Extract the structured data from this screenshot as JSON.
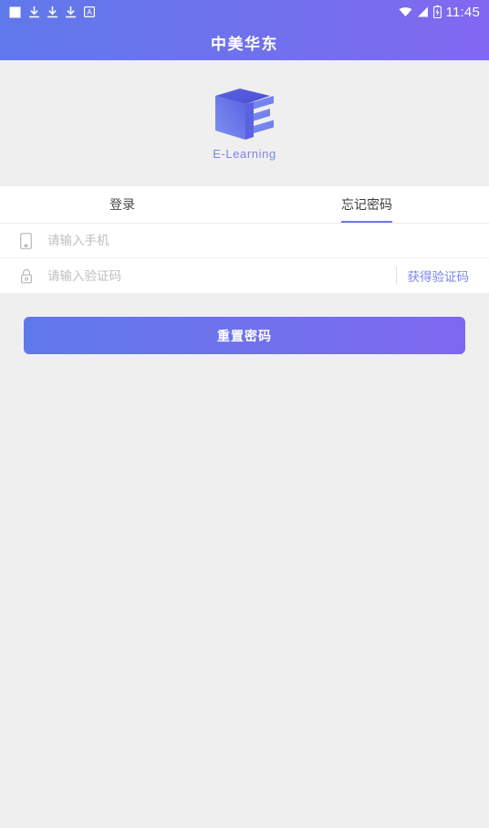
{
  "status_bar": {
    "left_icons": [
      "white-square-icon",
      "download-icon",
      "download-icon",
      "download-icon",
      "app-letter-a-icon"
    ],
    "right_icons": [
      "wifi-icon",
      "signal-icon",
      "battery-charging-icon"
    ],
    "time": "11:45"
  },
  "header": {
    "title": "中美华东",
    "gradient_start": "#6079ea",
    "gradient_end": "#8168f0"
  },
  "logo": {
    "text": "E-Learning",
    "text_color": "#7b86e8",
    "icon": "e-learning-cube-logo"
  },
  "tabs": [
    {
      "label": "登录",
      "active": false
    },
    {
      "label": "忘记密码",
      "active": true
    }
  ],
  "form": {
    "phone": {
      "icon": "mobile-phone-icon",
      "placeholder": "请输入手机",
      "value": ""
    },
    "code": {
      "icon": "lock-icon",
      "placeholder": "请输入验证码",
      "value": "",
      "action_label": "获得验证码",
      "action_color": "#7b86e8"
    }
  },
  "submit": {
    "label": "重置密码",
    "gradient_start": "#6079ea",
    "gradient_end": "#7f68f0"
  }
}
